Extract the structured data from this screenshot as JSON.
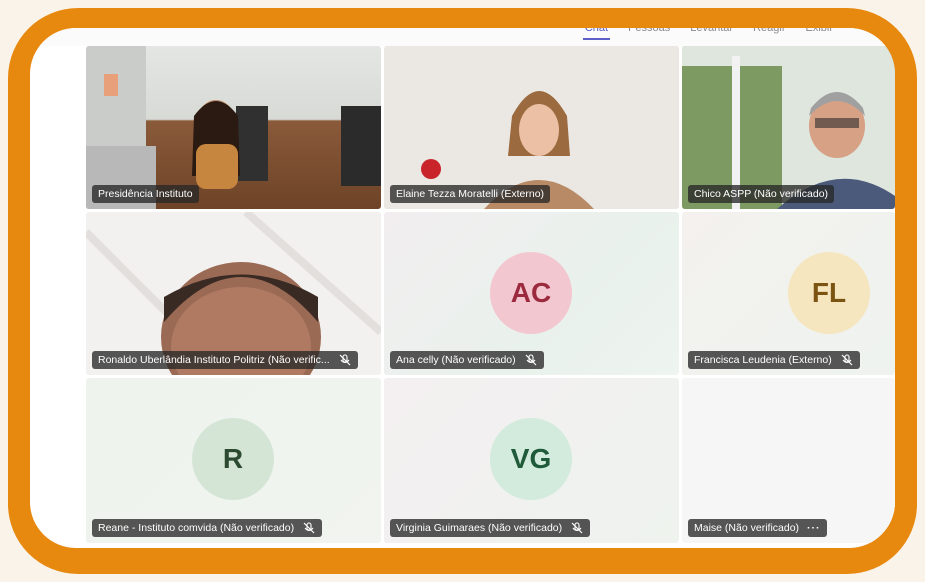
{
  "tabs": [
    {
      "label": "Chat",
      "active": true
    },
    {
      "label": "Pessoas"
    },
    {
      "label": "Levantar"
    },
    {
      "label": "Reagir"
    },
    {
      "label": "Exibir"
    }
  ],
  "participants": [
    {
      "name": "Presidência Instituto"
    },
    {
      "name": "Elaine Tezza Moratelli (Externo)"
    },
    {
      "name": "Chico ASPP (Não verificado)"
    },
    {
      "name": "Ronaldo Uberlândia Instituto Politriz (Não verific..."
    },
    {
      "name": "Ana celly (Não verificado)",
      "initials": "AC"
    },
    {
      "name": "Francisca Leudenia (Externo)",
      "initials": "FL"
    },
    {
      "name": "Reane - Instituto comvida (Não verificado)",
      "initials": "R"
    },
    {
      "name": "Virginia Guimaraes (Não verificado)",
      "initials": "VG"
    },
    {
      "name": "Maise (Não verificado)",
      "more": "···"
    }
  ],
  "colors": {
    "frame": "#e8890f",
    "accent": "#5b5fc7"
  }
}
